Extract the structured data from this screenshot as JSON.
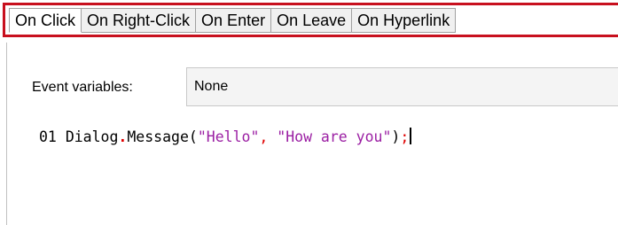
{
  "tabs": [
    {
      "label": "On Click",
      "active": true
    },
    {
      "label": "On Right-Click",
      "active": false
    },
    {
      "label": "On Enter",
      "active": false
    },
    {
      "label": "On Leave",
      "active": false
    },
    {
      "label": "On Hyperlink",
      "active": false
    }
  ],
  "event_variables": {
    "label": "Event variables:",
    "value": "None"
  },
  "code": {
    "line_number": "01",
    "object": "Dialog",
    "dot": ".",
    "method": "Message",
    "open_paren": "(",
    "arg1": "\"Hello\"",
    "comma": ",",
    "arg2": "\"How are you\"",
    "close_paren": ")",
    "semicolon": ";"
  },
  "colors": {
    "tab_highlight": "#c8101e",
    "string": "#9b1fa3",
    "operator": "#e00000"
  }
}
